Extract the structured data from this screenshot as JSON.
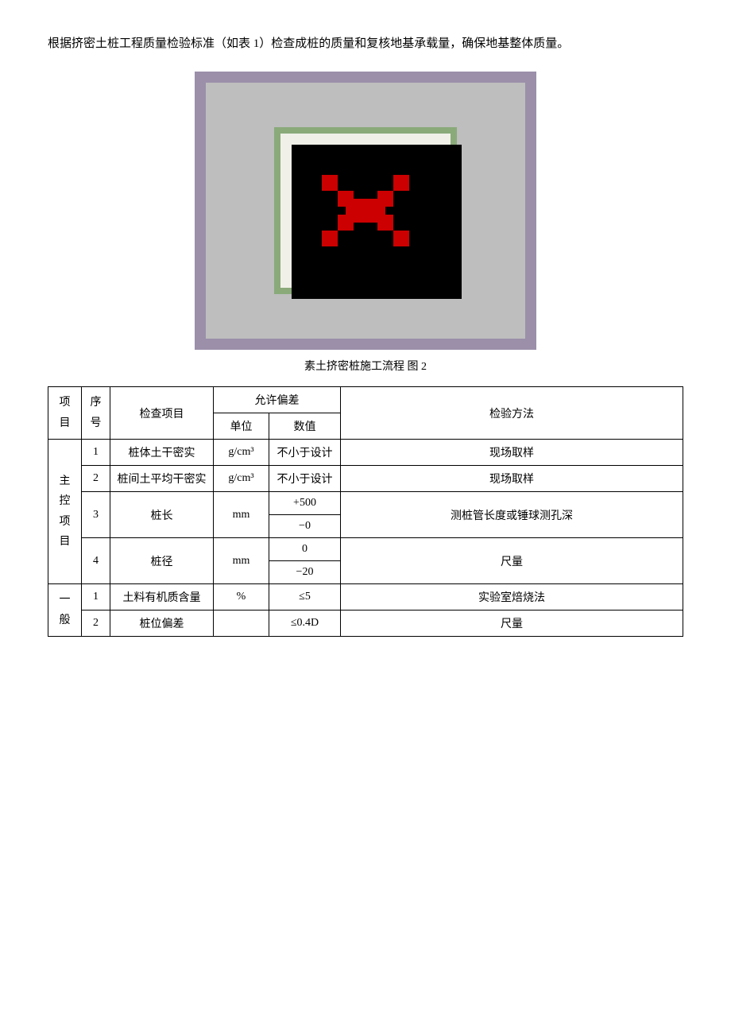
{
  "intro": {
    "text": "根据挤密土桩工程质量检验标准（如表 1）检查成桩的质量和复核地基承载量，确保地基整体质量。"
  },
  "diagram": {
    "caption": "素土挤密桩施工流程  图 2"
  },
  "table": {
    "headers": {
      "xm": "项\n目",
      "xh": "序\n号",
      "jcxm": "检查项目",
      "yunxupiancha": "允许偏差",
      "dw": "单位",
      "sz": "数值",
      "jyfz": "检验方法"
    },
    "rows": [
      {
        "group": "主\n控\n项\n目",
        "seq": "1",
        "item": "桩体土干密实",
        "unit": "g/cm³",
        "value": "不小于设计",
        "method": "现场取样",
        "rowspan": 1
      },
      {
        "group": "",
        "seq": "2",
        "item": "桩间土平均干密实",
        "unit": "g/cm³",
        "value": "不小于设计",
        "method": "现场取样",
        "rowspan": 1
      },
      {
        "group": "",
        "seq": "3",
        "item": "桩长",
        "unit": "mm",
        "value": "+500",
        "value2": "−0",
        "method": "测桩管长度或锤球测孔深",
        "rowspan": 2
      },
      {
        "group": "",
        "seq": "4",
        "item": "桩径",
        "unit": "mm",
        "value": "0",
        "value2": "−20",
        "method": "尺量",
        "rowspan": 2
      }
    ],
    "rows2": [
      {
        "group": "一\n般",
        "seq": "1",
        "item": "土料有机质含量",
        "unit": "%",
        "value": "≤5",
        "method": "实验室焙烧法"
      },
      {
        "group": "",
        "seq": "2",
        "item": "桩位偏差",
        "unit": "",
        "value": "≤0.4D",
        "method": "尺量"
      }
    ]
  }
}
